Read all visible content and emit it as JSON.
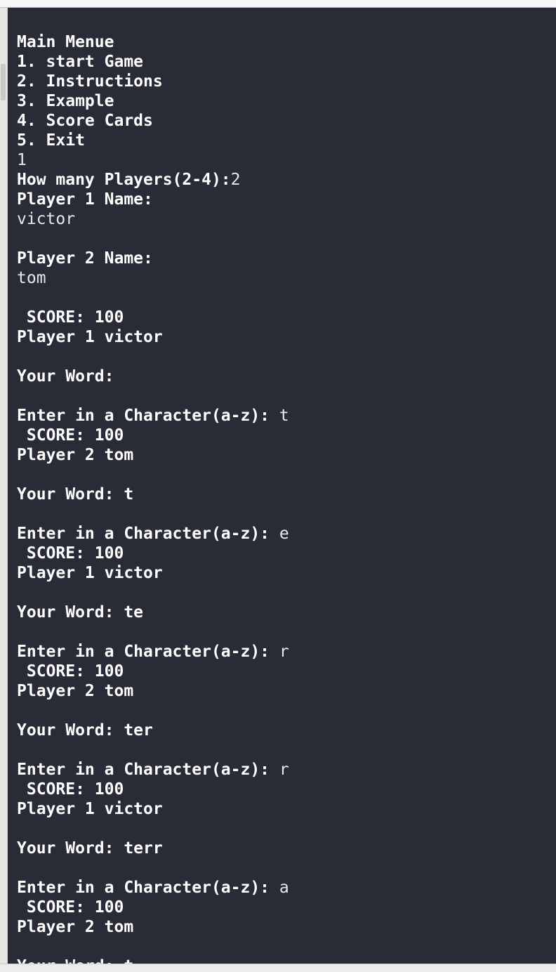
{
  "console": {
    "lines": [
      {
        "o": "Main Menue",
        "i": ""
      },
      {
        "o": "1. start Game",
        "i": ""
      },
      {
        "o": "2. Instructions",
        "i": ""
      },
      {
        "o": "3. Example",
        "i": ""
      },
      {
        "o": "4. Score Cards",
        "i": ""
      },
      {
        "o": "5. Exit",
        "i": ""
      },
      {
        "o": "",
        "i": "1"
      },
      {
        "o": "How many Players(2-4):",
        "i": "2"
      },
      {
        "o": "Player 1 Name:",
        "i": ""
      },
      {
        "o": "",
        "i": "victor"
      },
      {
        "o": "",
        "i": ""
      },
      {
        "o": "Player 2 Name:",
        "i": ""
      },
      {
        "o": "",
        "i": "tom"
      },
      {
        "o": "",
        "i": ""
      },
      {
        "o": " SCORE: 100",
        "i": ""
      },
      {
        "o": "Player 1 victor",
        "i": ""
      },
      {
        "o": "",
        "i": ""
      },
      {
        "o": "Your Word:",
        "i": ""
      },
      {
        "o": "",
        "i": ""
      },
      {
        "o": "Enter in a Character(a-z): ",
        "i": "t"
      },
      {
        "o": " SCORE: 100",
        "i": ""
      },
      {
        "o": "Player 2 tom",
        "i": ""
      },
      {
        "o": "",
        "i": ""
      },
      {
        "o": "Your Word: t",
        "i": ""
      },
      {
        "o": "",
        "i": ""
      },
      {
        "o": "Enter in a Character(a-z): ",
        "i": "e"
      },
      {
        "o": " SCORE: 100",
        "i": ""
      },
      {
        "o": "Player 1 victor",
        "i": ""
      },
      {
        "o": "",
        "i": ""
      },
      {
        "o": "Your Word: te",
        "i": ""
      },
      {
        "o": "",
        "i": ""
      },
      {
        "o": "Enter in a Character(a-z): ",
        "i": "r"
      },
      {
        "o": " SCORE: 100",
        "i": ""
      },
      {
        "o": "Player 2 tom",
        "i": ""
      },
      {
        "o": "",
        "i": ""
      },
      {
        "o": "Your Word: ter",
        "i": ""
      },
      {
        "o": "",
        "i": ""
      },
      {
        "o": "Enter in a Character(a-z): ",
        "i": "r"
      },
      {
        "o": " SCORE: 100",
        "i": ""
      },
      {
        "o": "Player 1 victor",
        "i": ""
      },
      {
        "o": "",
        "i": ""
      },
      {
        "o": "Your Word: terr",
        "i": ""
      },
      {
        "o": "",
        "i": ""
      },
      {
        "o": "Enter in a Character(a-z): ",
        "i": "a"
      },
      {
        "o": " SCORE: 100",
        "i": ""
      },
      {
        "o": "Player 2 tom",
        "i": ""
      },
      {
        "o": "",
        "i": ""
      },
      {
        "o": "Your Word: t",
        "i": ""
      }
    ]
  },
  "colors": {
    "console_background": "#292c37",
    "output_text": "#ffffff",
    "input_text": "#e8e8ea",
    "window_chrome": "#ececec"
  }
}
